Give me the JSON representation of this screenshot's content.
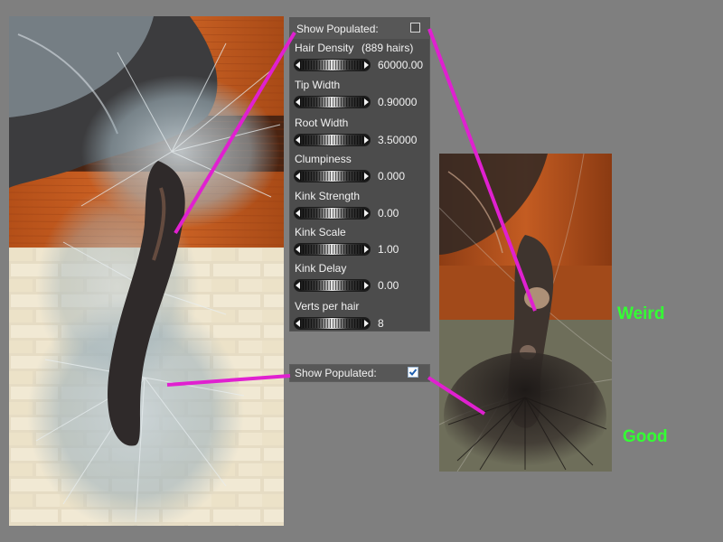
{
  "top_panel": {
    "show_populated_label": "Show Populated:",
    "show_populated_checked": false,
    "params": [
      {
        "label": "Hair Density",
        "extra": "(889 hairs)",
        "value": "60000.00"
      },
      {
        "label": "Tip Width",
        "extra": "",
        "value": "0.90000"
      },
      {
        "label": "Root Width",
        "extra": "",
        "value": "3.50000"
      },
      {
        "label": "Clumpiness",
        "extra": "",
        "value": "0.000"
      },
      {
        "label": "Kink Strength",
        "extra": "",
        "value": "0.00"
      },
      {
        "label": "Kink Scale",
        "extra": "",
        "value": "1.00"
      },
      {
        "label": "Kink Delay",
        "extra": "",
        "value": "0.00"
      },
      {
        "label": "Verts per hair",
        "extra": "",
        "value": "8"
      }
    ]
  },
  "bottom_panel": {
    "show_populated_label": "Show Populated:",
    "show_populated_checked": true
  },
  "notes": {
    "weird": "Weird",
    "good": "Good"
  },
  "colors": {
    "background": "#7f7f7f",
    "panel": "#4c4c4c",
    "annotation_line": "#e020d0",
    "note_text": "#33ff33"
  },
  "icons": [
    "slider-left-arrow-icon",
    "slider-right-arrow-icon",
    "checkmark-icon"
  ]
}
